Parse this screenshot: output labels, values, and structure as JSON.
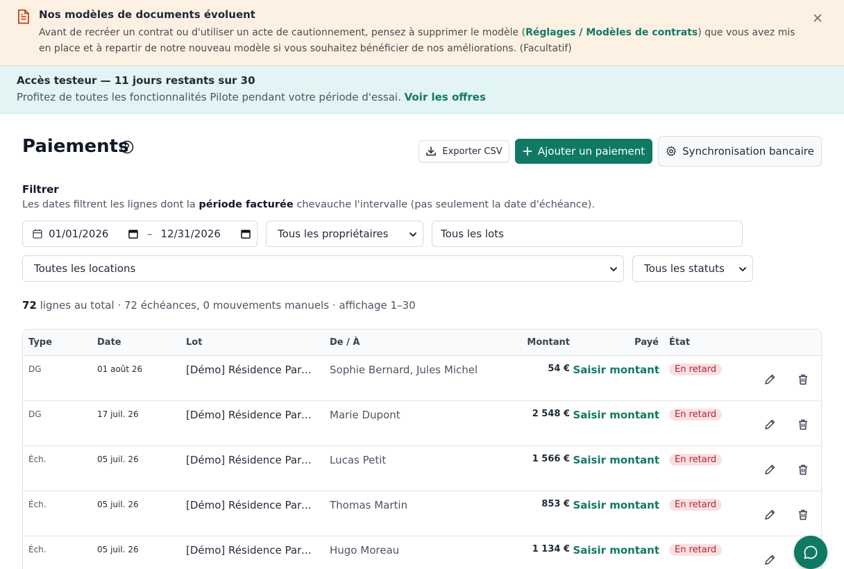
{
  "notice": {
    "title": "Nos modèles de documents évoluent",
    "text_before": "Avant de recréer un contrat ou d'utiliser un acte de cautionnement, pensez à supprimer le modèle (",
    "link": "Réglages / Modèles de contrats",
    "text_after": ") que vous avez mis en place et à repartir de notre nouveau modèle si vous souhaitez bénéficier de nos améliorations. (Facultatif)",
    "icon": "document-icon",
    "close_icon": "close-icon"
  },
  "trial": {
    "title": "Accès testeur — 11 jours restants sur 30",
    "text": "Profitez de toutes les fonctionnalités Pilote pendant votre période d'essai.",
    "link": "Voir les offres"
  },
  "header": {
    "title": "Paiements",
    "help_icon": "help-circle-icon",
    "export_label": "Exporter CSV",
    "add_label": "Ajouter un paiement",
    "sync_label": "Synchronisation bancaire"
  },
  "filter": {
    "title": "Filtrer",
    "desc_before": "Les dates filtrent les lignes dont la ",
    "desc_bold": "période facturée",
    "desc_after": " chevauche l'intervalle (pas seulement la date d'échéance).",
    "date_from": "01/01/2026",
    "date_sep": "–",
    "date_to": "12/31/2026",
    "owner": "Tous les propriétaires",
    "lots": "Tous les lots",
    "locations": "Toutes les locations",
    "status": "Tous les statuts"
  },
  "summary": {
    "count": "72",
    "text": " lignes au total · 72 échéances, 0 mouvements manuels · affichage 1–30"
  },
  "table": {
    "headers": {
      "type": "Type",
      "date": "Date",
      "lot": "Lot",
      "party": "De / À",
      "amount": "Montant",
      "paid": "Payé",
      "state": "État"
    },
    "rows": [
      {
        "type": "DG",
        "date": "01 août 26",
        "lot": "[Démo] Résidence Parc ...",
        "party": "Sophie Bernard, Jules Michel",
        "amount": "54 €",
        "paid": "Saisir montant",
        "state": "En retard"
      },
      {
        "type": "DG",
        "date": "17 juil. 26",
        "lot": "[Démo] Résidence Parc ...",
        "party": "Marie Dupont",
        "amount": "2 548 €",
        "paid": "Saisir montant",
        "state": "En retard"
      },
      {
        "type": "Éch.",
        "date": "05 juil. 26",
        "lot": "[Démo] Résidence Parc ...",
        "party": "Lucas Petit",
        "amount": "1 566 €",
        "paid": "Saisir montant",
        "state": "En retard"
      },
      {
        "type": "Éch.",
        "date": "05 juil. 26",
        "lot": "[Démo] Résidence Parc ...",
        "party": "Thomas Martin",
        "amount": "853 €",
        "paid": "Saisir montant",
        "state": "En retard"
      },
      {
        "type": "Éch.",
        "date": "05 juil. 26",
        "lot": "[Démo] Résidence Parc ...",
        "party": "Hugo Moreau",
        "amount": "1 134 €",
        "paid": "Saisir montant",
        "state": "En retard"
      }
    ]
  },
  "colors": {
    "accent": "#0f7a64",
    "notice_bg": "#fdf1e4",
    "trial_bg": "#e3f4f4",
    "late_bg": "#fbe0e2",
    "late_text": "#b4232f"
  }
}
